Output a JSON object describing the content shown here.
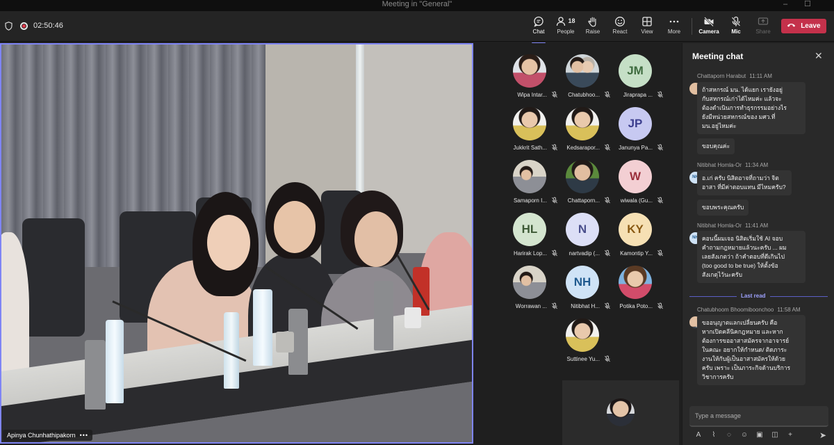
{
  "window": {
    "title": "Meeting in \"General\"",
    "minimize": "–",
    "maximize": "☐"
  },
  "toolbar": {
    "timer": "02:50:46",
    "buttons": {
      "chat": "Chat",
      "people": "People",
      "people_count": "18",
      "raise": "Raise",
      "react": "React",
      "view": "View",
      "more": "More",
      "camera": "Camera",
      "mic": "Mic",
      "share": "Share",
      "leave": "Leave"
    }
  },
  "main_video": {
    "speaker": "Apinya Chunhathipakorn",
    "more": "•••"
  },
  "participants": [
    {
      "name": "Wipa Intar...",
      "avatar": "photo"
    },
    {
      "name": "Chatubhoo...",
      "avatar": "photo"
    },
    {
      "name": "Jiraprapa ...",
      "initials": "JM",
      "color": "#c5dfc6",
      "text_color": "#3e6b3f"
    },
    {
      "name": "Jukkrit Sath...",
      "avatar": "photo"
    },
    {
      "name": "Kedsarapor...",
      "avatar": "photo"
    },
    {
      "name": "Janunya Pa...",
      "initials": "JP",
      "color": "#c7c9f1",
      "text_color": "#3d3f8f"
    },
    {
      "name": "Samaporn I...",
      "avatar": "photo"
    },
    {
      "name": "Chattaporn...",
      "avatar": "photo"
    },
    {
      "name": "wiwala (Gu...",
      "initials": "W",
      "color": "#f3cfd3",
      "text_color": "#9b2f3c"
    },
    {
      "name": "Harirak Lop...",
      "initials": "HL",
      "color": "#d4e5cf",
      "text_color": "#3e5a36"
    },
    {
      "name": "nartvadip (...",
      "initials": "N",
      "color": "#dcdff6",
      "text_color": "#4a4f8c"
    },
    {
      "name": "Kamontip Y...",
      "initials": "KY",
      "color": "#f6e0b4",
      "text_color": "#8a5a14"
    },
    {
      "name": "Worrawan ...",
      "avatar": "photo"
    },
    {
      "name": "Nitibhat H...",
      "initials": "NH",
      "color": "#cfe3f6",
      "text_color": "#1f5a8f"
    },
    {
      "name": "Potika Poto...",
      "avatar": "photo"
    },
    {
      "name": "Suttinee Yu...",
      "avatar": "photo"
    }
  ],
  "chat": {
    "title": "Meeting chat",
    "close": "✕",
    "messages": [
      {
        "sender": "Chattaporn Harabut",
        "time": "11:11 AM",
        "lines": [
          "ถ้าสหกรณ์ มน. ได้แยก เรายังอยู่",
          "กับสหกรณ์เก่าได้ไหมค่ะ แล้วจะ",
          "ต้องดำเนินการทำธุรกรรมอย่างไร",
          "ยังมีหน่วยสหกรณ์ของ มศว.ที่",
          "มน.อยู่ไหมค่ะ"
        ],
        "followup": "ขอบคุณค่ะ"
      },
      {
        "sender": "Nitibhat Homla-Or",
        "time": "11:34 AM",
        "initials": "NH",
        "lines": [
          "อ.เก่ ครับ นิสิตอาจที่ถามว่า จิต",
          "อาสา ที่มีค่าตอบแทน มีไหมครับ?"
        ],
        "followup": "ขอบพระคุณครับ"
      },
      {
        "sender": "Nitibhat Homla-Or",
        "time": "11:41 AM",
        "initials": "NH",
        "lines": [
          "คอนนี้ผมเจอ นิสิตเริ่มใช้ AI จอบ",
          "คำถามกฎหมายแล้วนะครับ ... ผม",
          "เลยสังเกตว่า ถ้าคำตอบที่ดีเกินไป",
          "(too good to be true) ให้ตั้งข้อ",
          "สังเกตุไว้นะครับ"
        ]
      },
      {
        "sender": "Chatubhoom Bhoomiboonchoo",
        "time": "11:58 AM",
        "lines": [
          "ขออนุญาตแลกเปลี่ยนครับ  คือ",
          "หากเปิดคลีนิคกฎหมาย และหาก",
          "ต้องการขออาสาสมัครจากอาจารย์",
          "ในคณะ อยากให้กำหนด/ ติดภาระ",
          "งานให้กับผู้เป็นอาสาสมัครให้ด้วย",
          "ครับ เพราะ เป็นภาระกิจด้านบริการ",
          "วิชาการครับ"
        ]
      }
    ],
    "last_read": "Last read",
    "compose_placeholder": "Type a message"
  },
  "colors": {
    "accent": "#7f85f5",
    "leave": "#c4314b",
    "panel": "#292929",
    "toolbar": "#242424"
  }
}
